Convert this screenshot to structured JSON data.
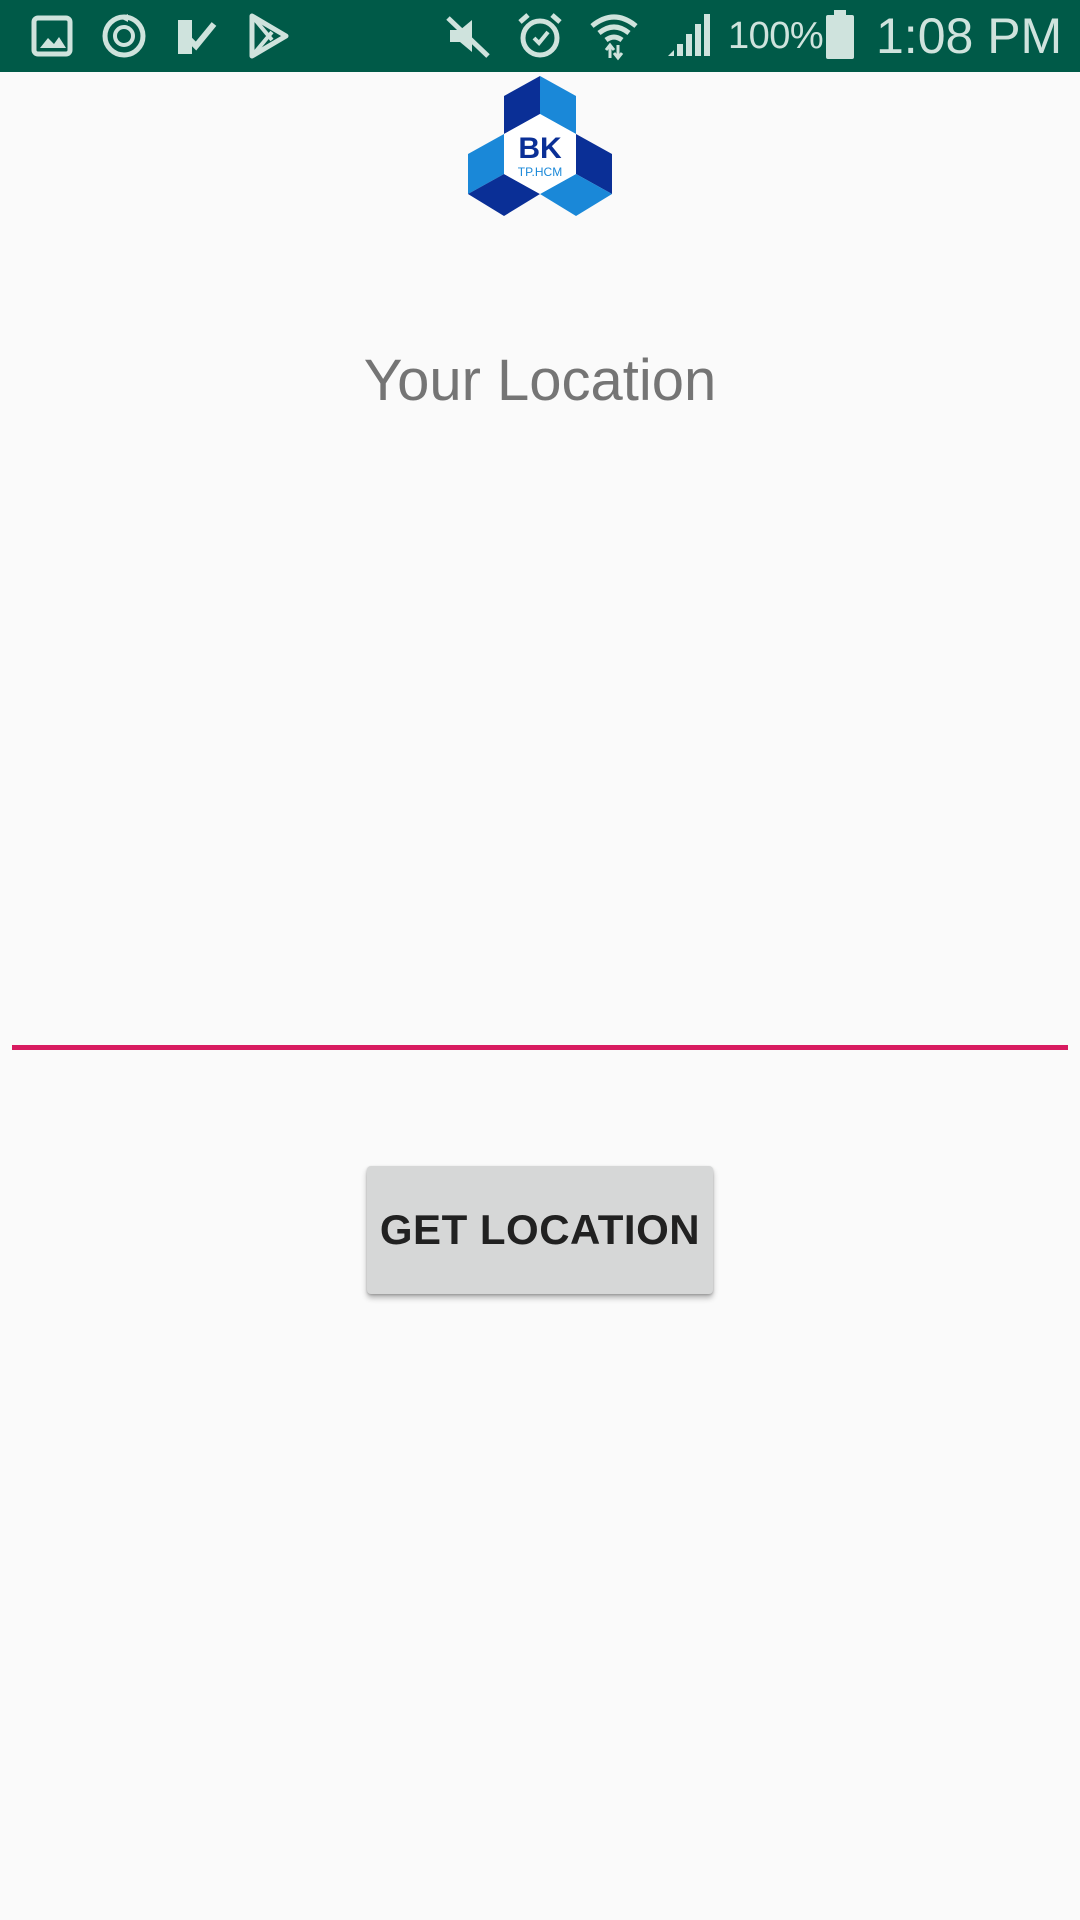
{
  "status_bar": {
    "background": "#005a48",
    "left_icons": [
      "gallery-icon",
      "sync-icon",
      "task-check-icon",
      "play-store-icon"
    ],
    "right_icons": [
      "mute-icon",
      "alarm-icon",
      "wifi-icon",
      "signal-icon",
      "battery-icon"
    ],
    "battery_percent": "100%",
    "time": "1:08 PM"
  },
  "logo": {
    "name": "bk-tphcm-logo",
    "text_main": "BK",
    "text_sub": "TP.HCM",
    "colors": {
      "dark": "#0a2f96",
      "light": "#1a88d8"
    }
  },
  "main": {
    "title": "Your Location",
    "location_field": {
      "value": "",
      "underline_color": "#d81b60"
    },
    "get_location_button": {
      "label": "GET LOCATION"
    }
  }
}
